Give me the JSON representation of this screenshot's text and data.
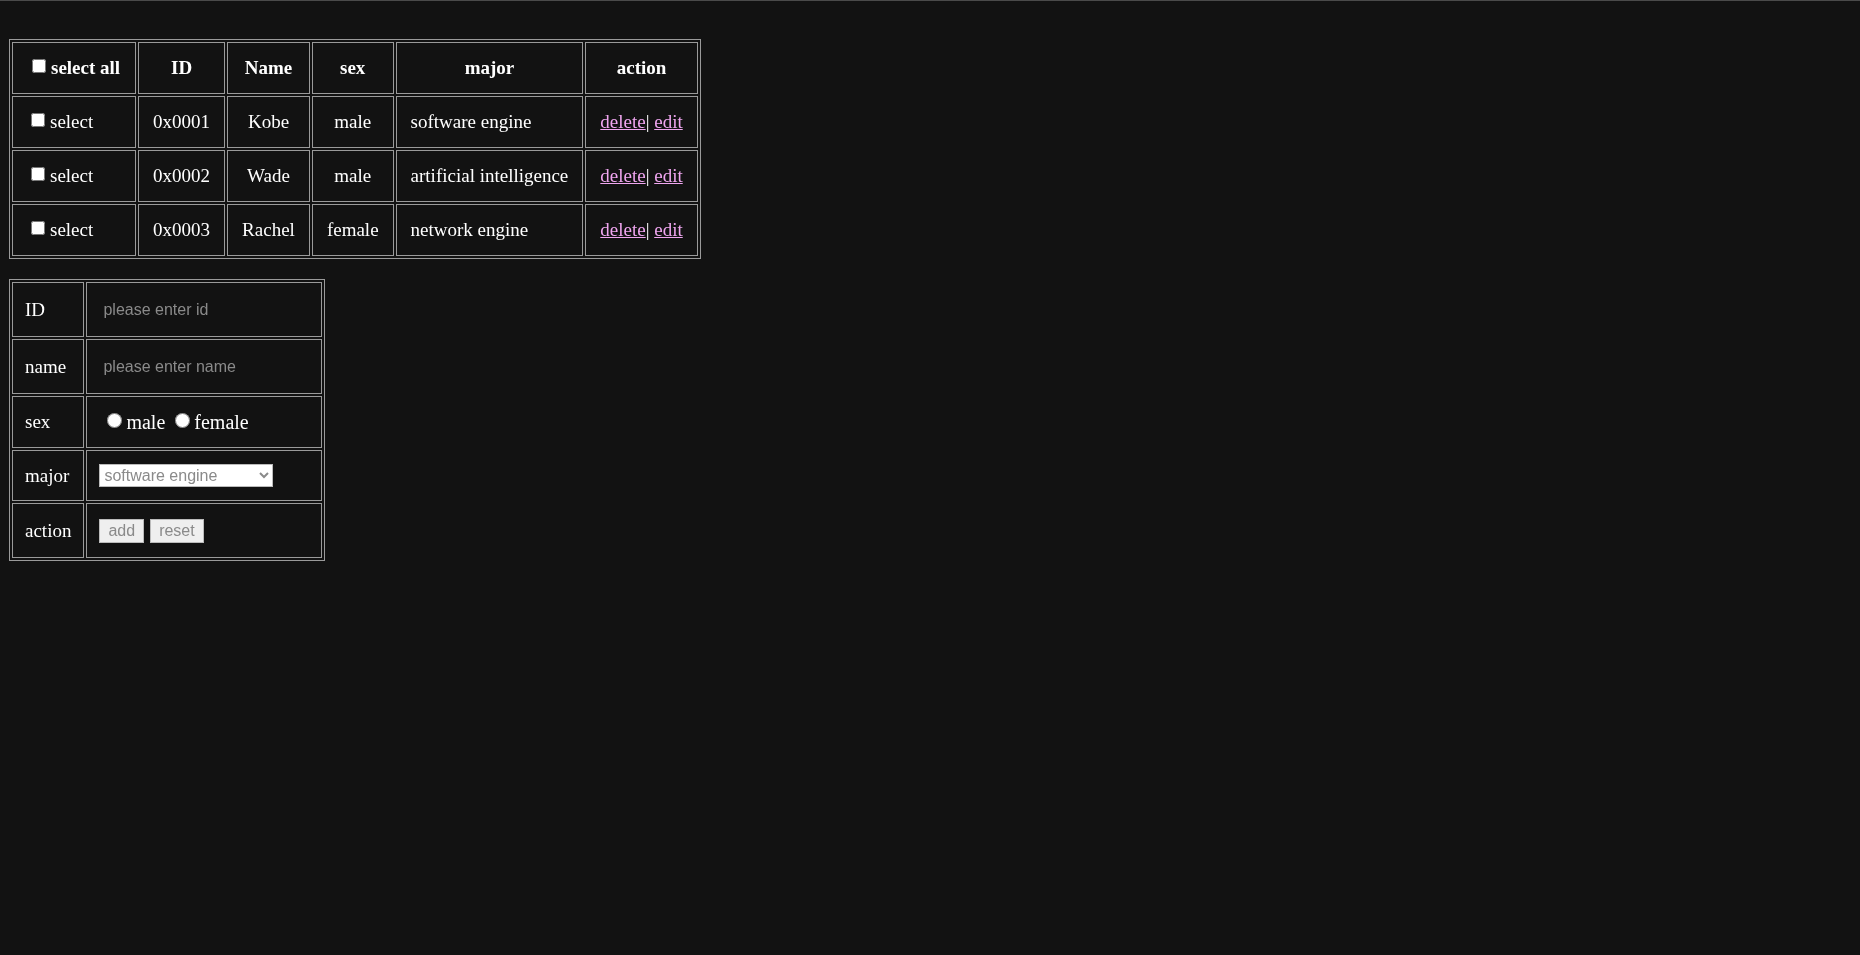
{
  "students_table": {
    "select_all": {
      "label": "select all",
      "checked": false
    },
    "columns": [
      "ID",
      "Name",
      "sex",
      "major",
      "action"
    ],
    "rows": [
      {
        "select_label": "select",
        "checked": false,
        "id": "0x0001",
        "name": "Kobe",
        "sex": "male",
        "major": "software engine",
        "links": [
          "delete",
          "edit"
        ],
        "separator": "|"
      },
      {
        "select_label": "select",
        "checked": false,
        "id": "0x0002",
        "name": "Wade",
        "sex": "male",
        "major": "artificial intelligence",
        "links": [
          "delete",
          "edit"
        ],
        "separator": "|"
      },
      {
        "select_label": "select",
        "checked": false,
        "id": "0x0003",
        "name": "Rachel",
        "sex": "female",
        "major": "network engine",
        "links": [
          "delete",
          "edit"
        ],
        "separator": "|"
      }
    ]
  },
  "form": {
    "id": {
      "label": "ID",
      "placeholder": "please enter id"
    },
    "name": {
      "label": "name",
      "placeholder": "please enter name"
    },
    "sex": {
      "label": "sex",
      "options": [
        {
          "label": "male",
          "selected": false
        },
        {
          "label": "female",
          "selected": false
        }
      ]
    },
    "major": {
      "label": "major",
      "value": "software engine",
      "disabled": true
    },
    "action": {
      "label": "action",
      "buttons": [
        {
          "label": "add",
          "disabled": true
        },
        {
          "label": "reset",
          "disabled": true
        }
      ]
    }
  }
}
